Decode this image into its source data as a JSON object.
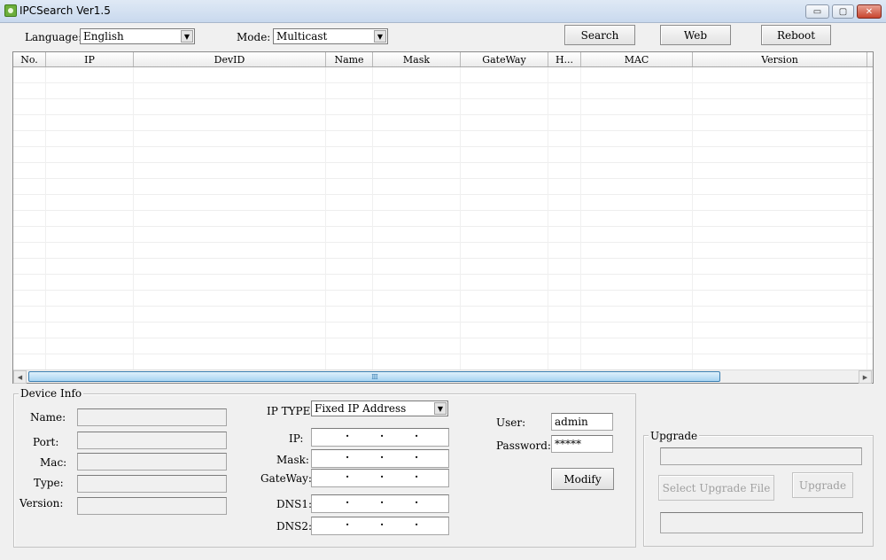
{
  "window": {
    "title": "IPCSearch Ver1.5",
    "controls": {
      "minimize": "▭",
      "maximize": "▢",
      "close": "✕"
    }
  },
  "toolbar": {
    "language_label": "Language:",
    "language_value": "English",
    "mode_label": "Mode:",
    "mode_value": "Multicast",
    "search_label": "Search",
    "web_label": "Web",
    "reboot_label": "Reboot"
  },
  "table": {
    "columns": [
      "No.",
      "IP",
      "DevID",
      "Name",
      "Mask",
      "GateWay",
      "H...",
      "MAC",
      "Version"
    ],
    "rows": [],
    "scroll_grip": "III"
  },
  "device_info": {
    "title": "Device Info",
    "name_label": "Name:",
    "port_label": "Port:",
    "mac_label": "Mac:",
    "type_label": "Type:",
    "version_label": "Version:",
    "name_value": "",
    "port_value": "",
    "mac_value": "",
    "type_value": "",
    "version_value": "",
    "ip_type_label": "IP TYPE",
    "ip_type_value": "Fixed IP Address",
    "ip_label": "IP:",
    "mask_label": "Mask:",
    "gateway_label": "GateWay:",
    "dns1_label": "DNS1:",
    "dns2_label": "DNS2:",
    "user_label": "User:",
    "user_value": "admin",
    "password_label": "Password:",
    "password_value": "*****",
    "modify_label": "Modify"
  },
  "upgrade": {
    "title": "Upgrade",
    "file_path_value": "",
    "select_file_label": "Select Upgrade File",
    "upgrade_label": "Upgrade",
    "status_value": ""
  }
}
